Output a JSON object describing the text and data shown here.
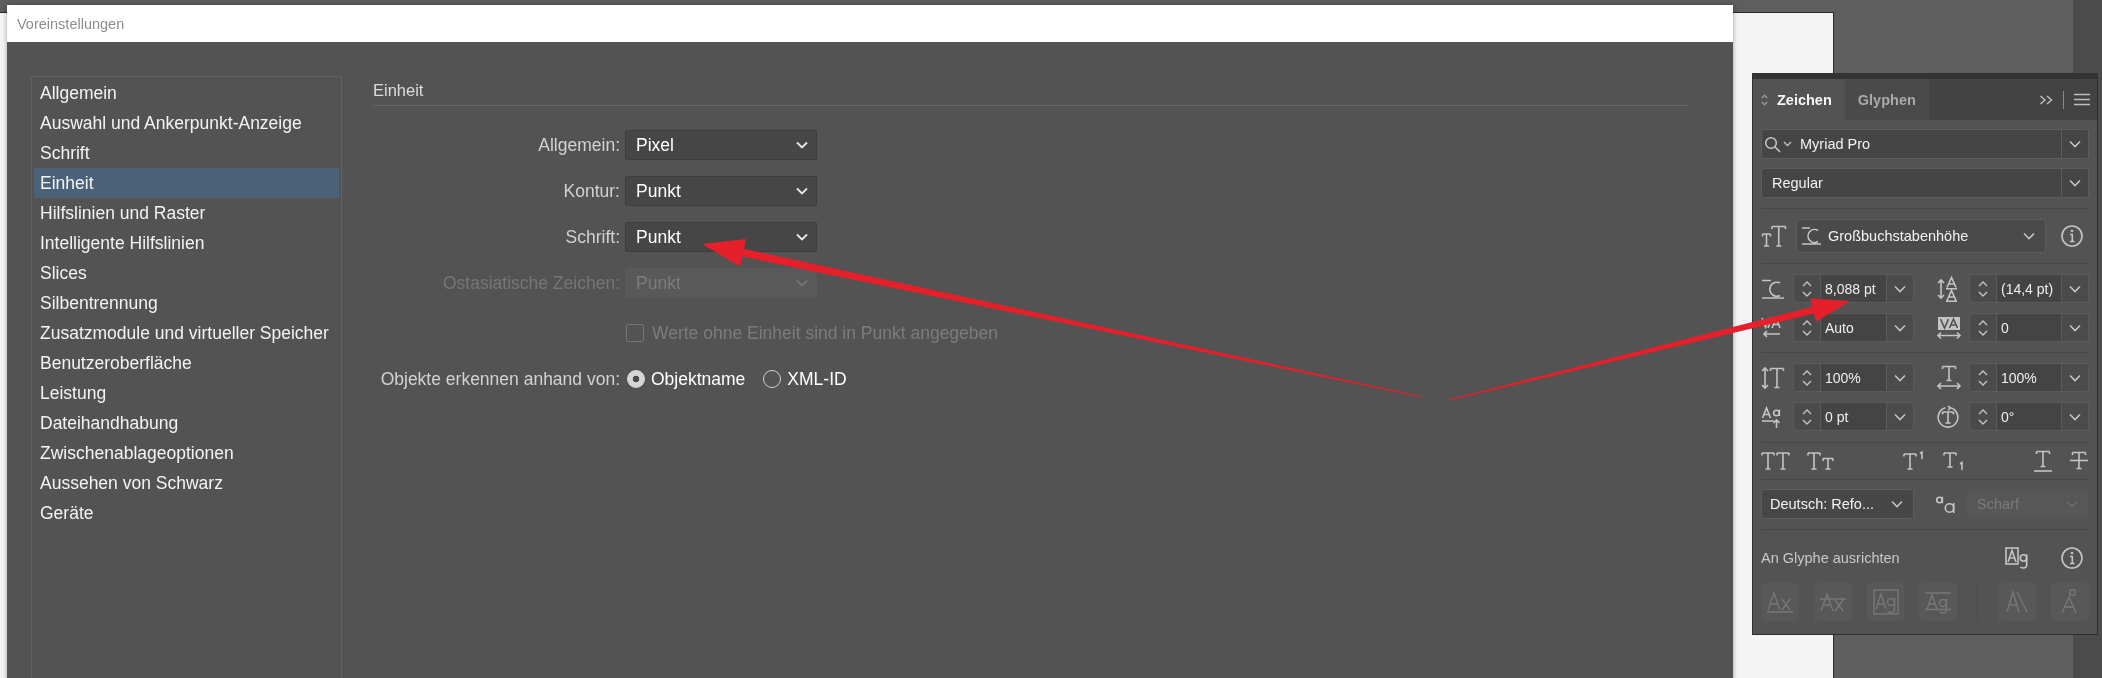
{
  "dialog": {
    "title": "Voreinstellungen",
    "sidebar": {
      "items": [
        {
          "label": "Allgemein",
          "selected": false
        },
        {
          "label": "Auswahl und Ankerpunkt-Anzeige",
          "selected": false
        },
        {
          "label": "Schrift",
          "selected": false
        },
        {
          "label": "Einheit",
          "selected": true
        },
        {
          "label": "Hilfslinien und Raster",
          "selected": false
        },
        {
          "label": "Intelligente Hilfslinien",
          "selected": false
        },
        {
          "label": "Slices",
          "selected": false
        },
        {
          "label": "Silbentrennung",
          "selected": false
        },
        {
          "label": "Zusatzmodule und virtueller Speicher",
          "selected": false
        },
        {
          "label": "Benutzeroberfläche",
          "selected": false
        },
        {
          "label": "Leistung",
          "selected": false
        },
        {
          "label": "Dateihandhabung",
          "selected": false
        },
        {
          "label": "Zwischenablageoptionen",
          "selected": false
        },
        {
          "label": "Aussehen von Schwarz",
          "selected": false
        },
        {
          "label": "Geräte",
          "selected": false
        }
      ]
    },
    "section": {
      "title": "Einheit",
      "fields": [
        {
          "label": "Allgemein:",
          "value": "Pixel",
          "disabled": false
        },
        {
          "label": "Kontur:",
          "value": "Punkt",
          "disabled": false
        },
        {
          "label": "Schrift:",
          "value": "Punkt",
          "disabled": false
        },
        {
          "label": "Ostasiatische Zeichen:",
          "value": "Punkt",
          "disabled": true
        }
      ],
      "checkbox": {
        "label": "Werte ohne Einheit sind in Punkt angegeben",
        "checked": false,
        "disabled": true
      },
      "identify_by": {
        "label": "Objekte erkennen anhand von:",
        "options": [
          {
            "label": "Objektname",
            "selected": true
          },
          {
            "label": "XML-ID",
            "selected": false
          }
        ]
      }
    }
  },
  "character_panel": {
    "tabs": [
      {
        "label": "Zeichen",
        "selected": true
      },
      {
        "label": "Glyphen",
        "selected": false
      }
    ],
    "font_family": "Myriad Pro",
    "font_style": "Regular",
    "size_reference": "Großbuchstabenhöhe",
    "fields": [
      {
        "kind": "size",
        "value": "8,088 pt"
      },
      {
        "kind": "leading",
        "value": "(14,4 pt)"
      },
      {
        "kind": "kerning",
        "value": "Auto"
      },
      {
        "kind": "tracking",
        "value": "0"
      },
      {
        "kind": "vscale",
        "value": "100%"
      },
      {
        "kind": "hscale",
        "value": "100%"
      },
      {
        "kind": "baseline",
        "value": "0 pt"
      },
      {
        "kind": "rotation",
        "value": "0°"
      }
    ],
    "language": "Deutsch: Refo...",
    "antialiasing": {
      "value": "Scharf",
      "disabled": true
    },
    "snap_label": "An Glyphe ausrichten",
    "snap_buttons": [
      {
        "kind": "baseline",
        "disabled": true
      },
      {
        "kind": "xheight",
        "disabled": true
      },
      {
        "kind": "bounds",
        "disabled": true
      },
      {
        "kind": "proximity",
        "disabled": true
      },
      {
        "kind": "angular",
        "disabled": true
      },
      {
        "kind": "anchor",
        "disabled": true
      }
    ]
  }
}
